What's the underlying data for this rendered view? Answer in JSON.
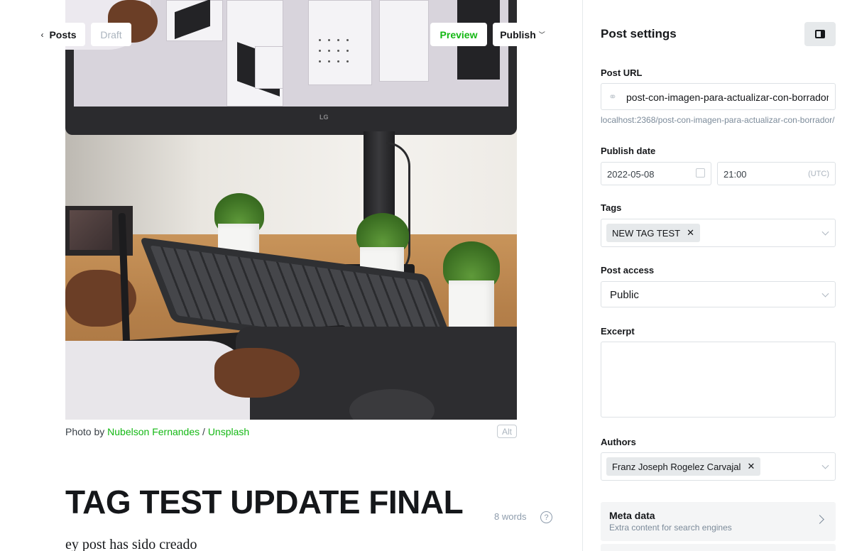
{
  "toolbar": {
    "back_label": "Posts",
    "status_label": "Draft",
    "preview_label": "Preview",
    "publish_label": "Publish"
  },
  "feature_image": {
    "caption_prefix": "Photo by ",
    "author_link": "Nubelson Fernandes",
    "separator": " / ",
    "source_link": "Unsplash",
    "alt_label": "Alt",
    "monitor_logo": "LG"
  },
  "post": {
    "title": "TAG TEST UPDATE FINAL",
    "word_count": "8 words",
    "help_glyph": "?",
    "body": "ey post has sido creado"
  },
  "settings": {
    "title": "Post settings",
    "url": {
      "label": "Post URL",
      "value": "post-con-imagen-para-actualizar-con-borrador",
      "hint": "localhost:2368/post-con-imagen-para-actualizar-con-borrador/"
    },
    "publish_date": {
      "label": "Publish date",
      "date": "2022-05-08",
      "time": "21:00",
      "timezone": "(UTC)"
    },
    "tags": {
      "label": "Tags",
      "items": [
        "NEW TAG TEST"
      ]
    },
    "access": {
      "label": "Post access",
      "value": "Public"
    },
    "excerpt": {
      "label": "Excerpt",
      "value": ""
    },
    "authors": {
      "label": "Authors",
      "items": [
        "Franz Joseph Rogelez Carvajal"
      ]
    },
    "meta": {
      "title": "Meta data",
      "subtitle": "Extra content for search engines"
    }
  },
  "colors": {
    "accent_green": "#14b814",
    "text_dark": "#15171a",
    "muted": "#7c8b9a",
    "border": "#dde1e5"
  }
}
